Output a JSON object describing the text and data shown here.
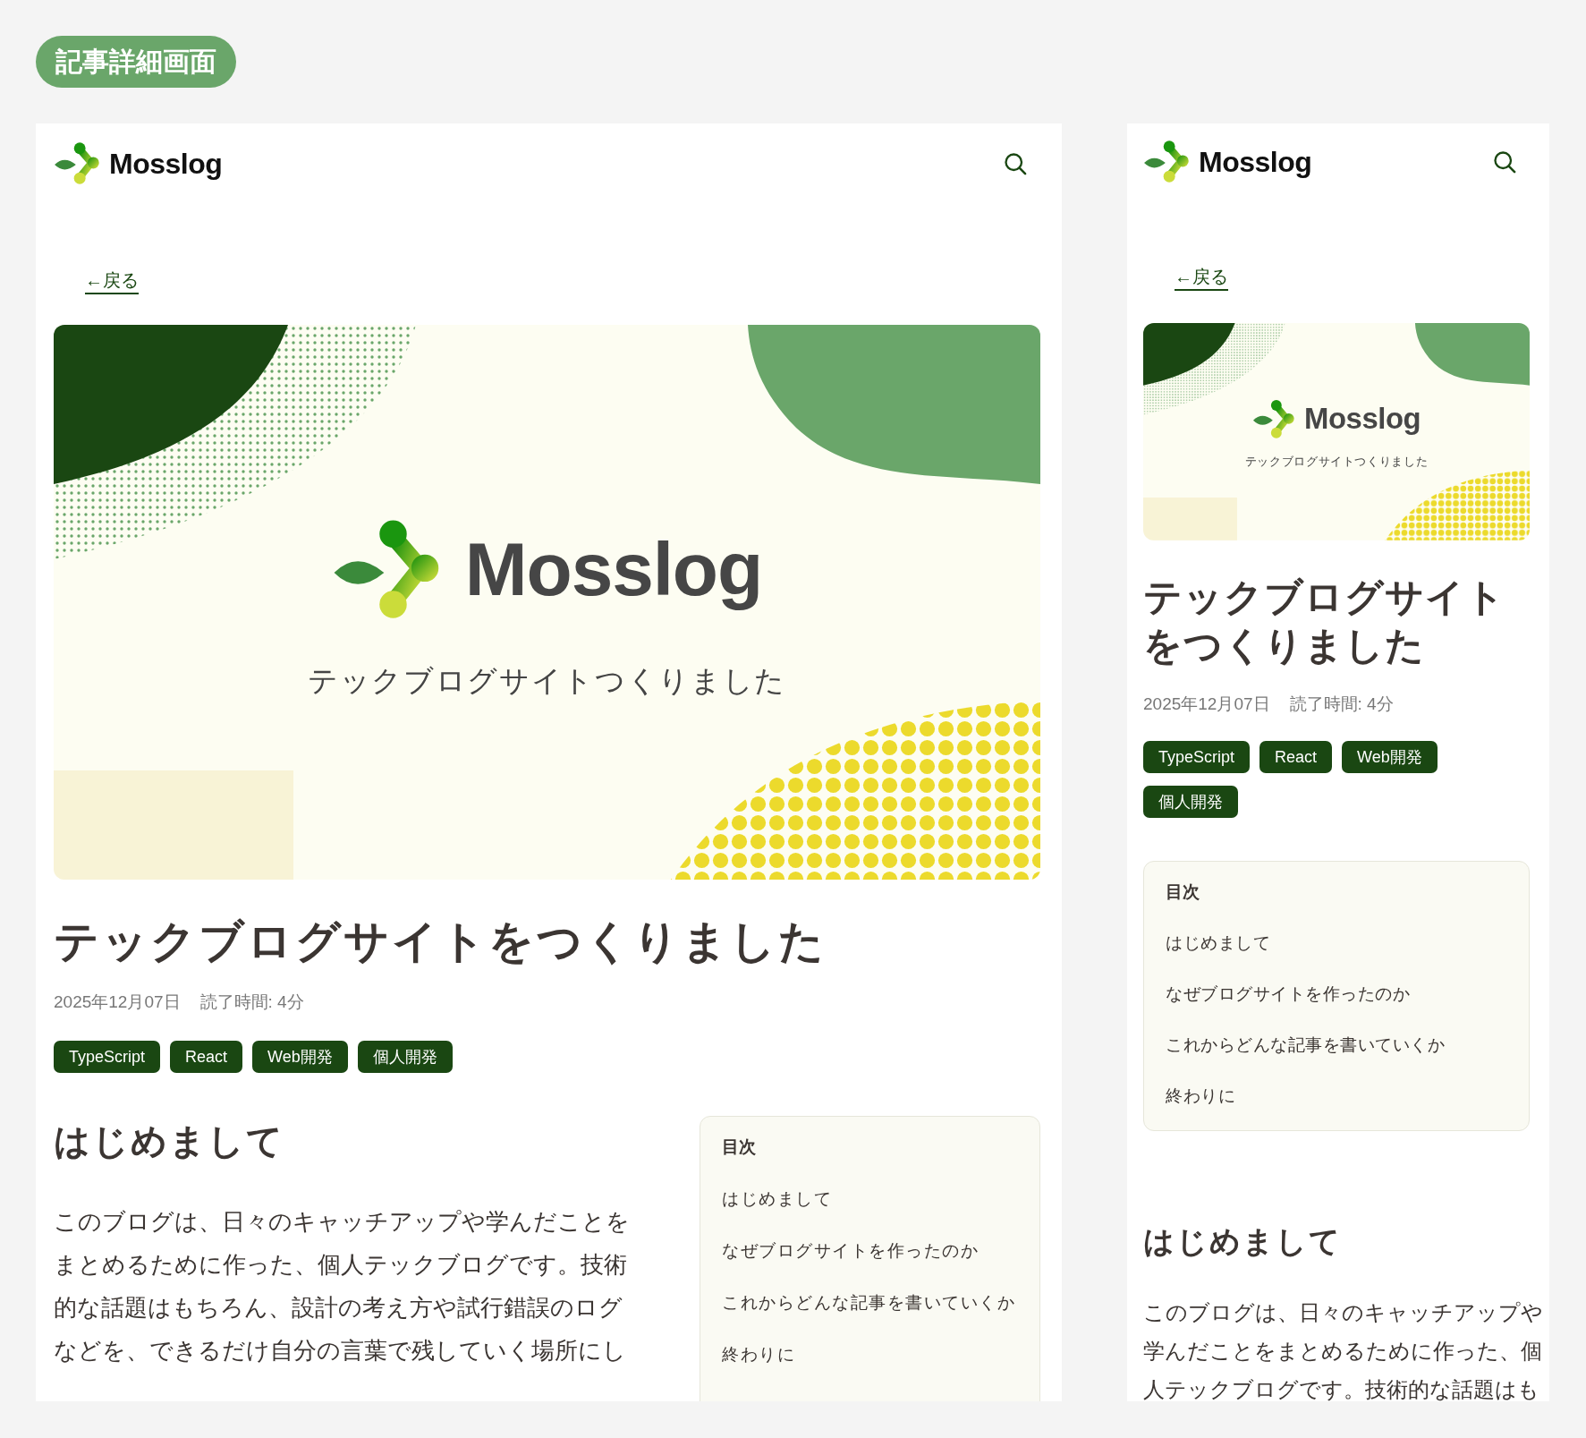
{
  "label": "記事詳細画面",
  "screens": [
    {
      "kind": "desktop",
      "header": {
        "logo": "Mosslog"
      },
      "back_link": "←戻る",
      "hero": {
        "logo": "Mosslog",
        "caption": "テックブログサイトつくりました"
      },
      "title": "テックブログサイトをつくりました",
      "date": "2025年12月07日",
      "read_time": "読了時間: 4分",
      "tags": [
        "TypeScript",
        "React",
        "Web開発",
        "個人開発"
      ],
      "toc": {
        "title": "目次",
        "items": [
          "はじめまして",
          "なぜブログサイトを作ったのか",
          "これからどんな記事を書いていくか",
          "終わりに"
        ]
      },
      "section_heading": "はじめまして",
      "paragraph": "このブログは、日々のキャッチアップや学んだことをまとめるために作った、個人テックブログです。技術的な話題はもちろん、設計の考え方や試行錯誤のログなどを、できるだけ自分の言葉で残していく場所にし"
    },
    {
      "kind": "mobile",
      "header": {
        "logo": "Mosslog"
      },
      "back_link": "←戻る",
      "hero": {
        "logo": "Mosslog",
        "caption": "テックブログサイトつくりました"
      },
      "title": "テックブログサイトをつくりました",
      "date": "2025年12月07日",
      "read_time": "読了時間: 4分",
      "tags": [
        "TypeScript",
        "React",
        "Web開発",
        "個人開発"
      ],
      "toc": {
        "title": "目次",
        "items": [
          "はじめまして",
          "なぜブログサイトを作ったのか",
          "これからどんな記事を書いていくか",
          "終わりに"
        ]
      },
      "section_heading": "はじめまして",
      "paragraph": "このブログは、日々のキャッチアップや学んだことをまとめるために作った、個人テックブログです。技術的な話題はも"
    }
  ]
}
